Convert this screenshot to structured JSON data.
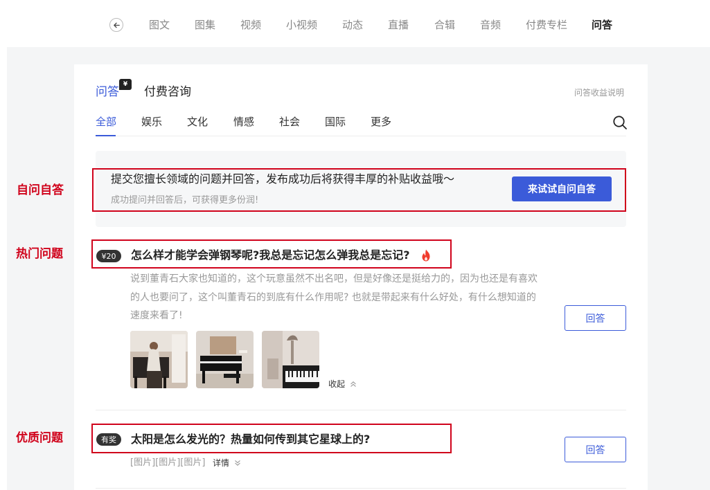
{
  "topnav": {
    "tabs": [
      "图文",
      "图集",
      "视频",
      "小视频",
      "动态",
      "直播",
      "合辑",
      "音频",
      "付费专栏",
      "问答"
    ],
    "active": "问答"
  },
  "header": {
    "qa_title": "问答",
    "yen_badge": "¥",
    "paid_title": "付费咨询",
    "income_link": "问答收益说明"
  },
  "categories": {
    "tabs": [
      "全部",
      "娱乐",
      "文化",
      "情感",
      "社会",
      "国际",
      "更多"
    ],
    "active": "全部"
  },
  "banner": {
    "title": "提交您擅长领域的问题并回答，发布成功后将获得丰厚的补贴收益哦～",
    "subtitle": "成功提问并回答后，可获得更多份润!",
    "button": "来试试自问自答"
  },
  "annotations": {
    "self_qa": "自问自答",
    "hot": "热门问题",
    "quality": "优质问题"
  },
  "questions": [
    {
      "badge": "¥20",
      "title": "怎么样才能学会弹钢琴呢?我总是忘记怎么弹我总是忘记?",
      "desc": "说到董青石大家也知道的，这个玩意虽然不出名吧，但是好像还是挺给力的，因为也还是有喜欢的人也要问了，这个叫董青石的到底有什么作用呢? 也就是带起来有什么好处，有什么想知道的速度来看了!",
      "collapse": "收起",
      "answer": "回答"
    },
    {
      "badge": "有奖",
      "title": "太阳是怎么发光的？热量如何传到其它星球上的?",
      "meta": "[图片][图片][图片]",
      "detail": "详情",
      "answer": "回答"
    }
  ],
  "colors": {
    "accent": "#3b5bd9",
    "annotation": "#d0021b"
  }
}
